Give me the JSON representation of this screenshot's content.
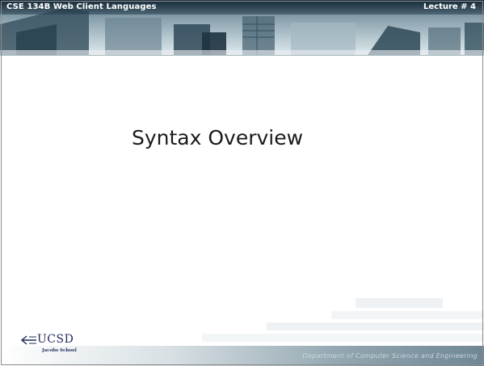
{
  "header": {
    "course_title": "CSE 134B  Web Client Languages",
    "lecture_number": "Lecture # 4"
  },
  "slide": {
    "title": "Syntax Overview"
  },
  "footer": {
    "department": "Department of Computer Science and Engineering",
    "logo_name": "UCSD",
    "logo_sub": "Jacobs School"
  },
  "colors": {
    "banner_dark": "#3f5a6a",
    "banner_light": "#dfe8ec",
    "title_text": "#1a1a1a",
    "logo_blue": "#1f2a5a",
    "footer_text": "#c9d6dc"
  }
}
